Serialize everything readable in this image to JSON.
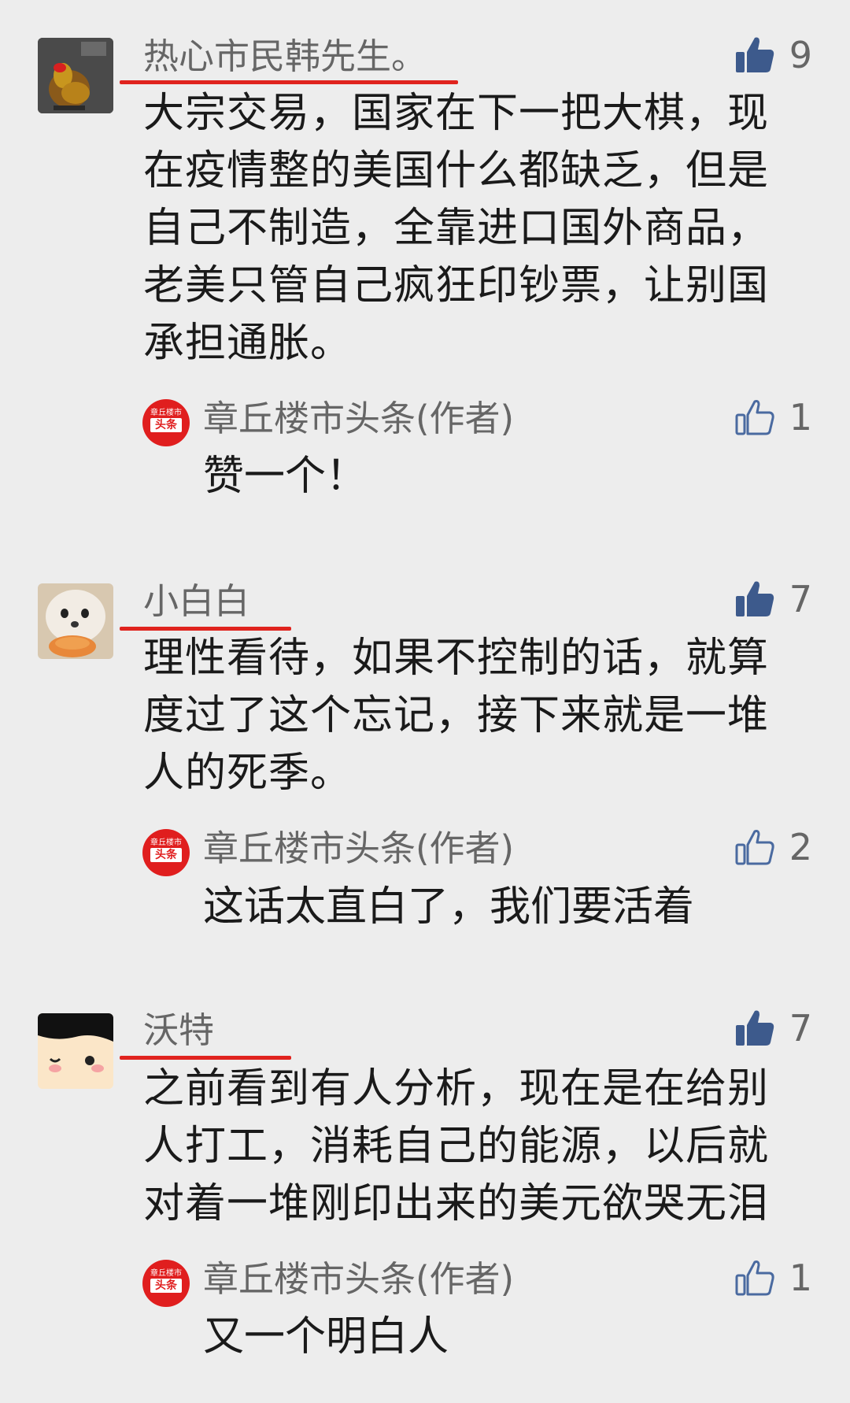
{
  "colors": {
    "accent_red": "#e0231e",
    "like_filled": "#3d5a8c",
    "like_outline": "#4a6aa0"
  },
  "comments": [
    {
      "author": "热心市民韩先生。",
      "likes": "9",
      "liked_icon": "thumbs-up-filled-icon",
      "body": "大宗交易，国家在下一把大棋，现在疫情整的美国什么都缺乏，但是自己不制造，全靠进口国外商品，老美只管自己疯狂印钞票，让别国承担通胀。",
      "reply": {
        "author": "章丘楼市头条(作者)",
        "avatar_top": "章丘楼市",
        "avatar_main": "头条",
        "likes": "1",
        "text": "赞一个！"
      }
    },
    {
      "author": "小白白",
      "likes": "7",
      "liked_icon": "thumbs-up-filled-icon",
      "body": "理性看待，如果不控制的话，就算度过了这个忘记，接下来就是一堆人的死季。",
      "reply": {
        "author": "章丘楼市头条(作者)",
        "avatar_top": "章丘楼市",
        "avatar_main": "头条",
        "likes": "2",
        "text": "这话太直白了，我们要活着"
      }
    },
    {
      "author": "沃特",
      "likes": "7",
      "liked_icon": "thumbs-up-filled-icon",
      "body": "之前看到有人分析，现在是在给别人打工，消耗自己的能源，以后就对着一堆刚印出来的美元欲哭无泪",
      "reply": {
        "author": "章丘楼市头条(作者)",
        "avatar_top": "章丘楼市",
        "avatar_main": "头条",
        "likes": "1",
        "text": "又一个明白人"
      }
    }
  ]
}
